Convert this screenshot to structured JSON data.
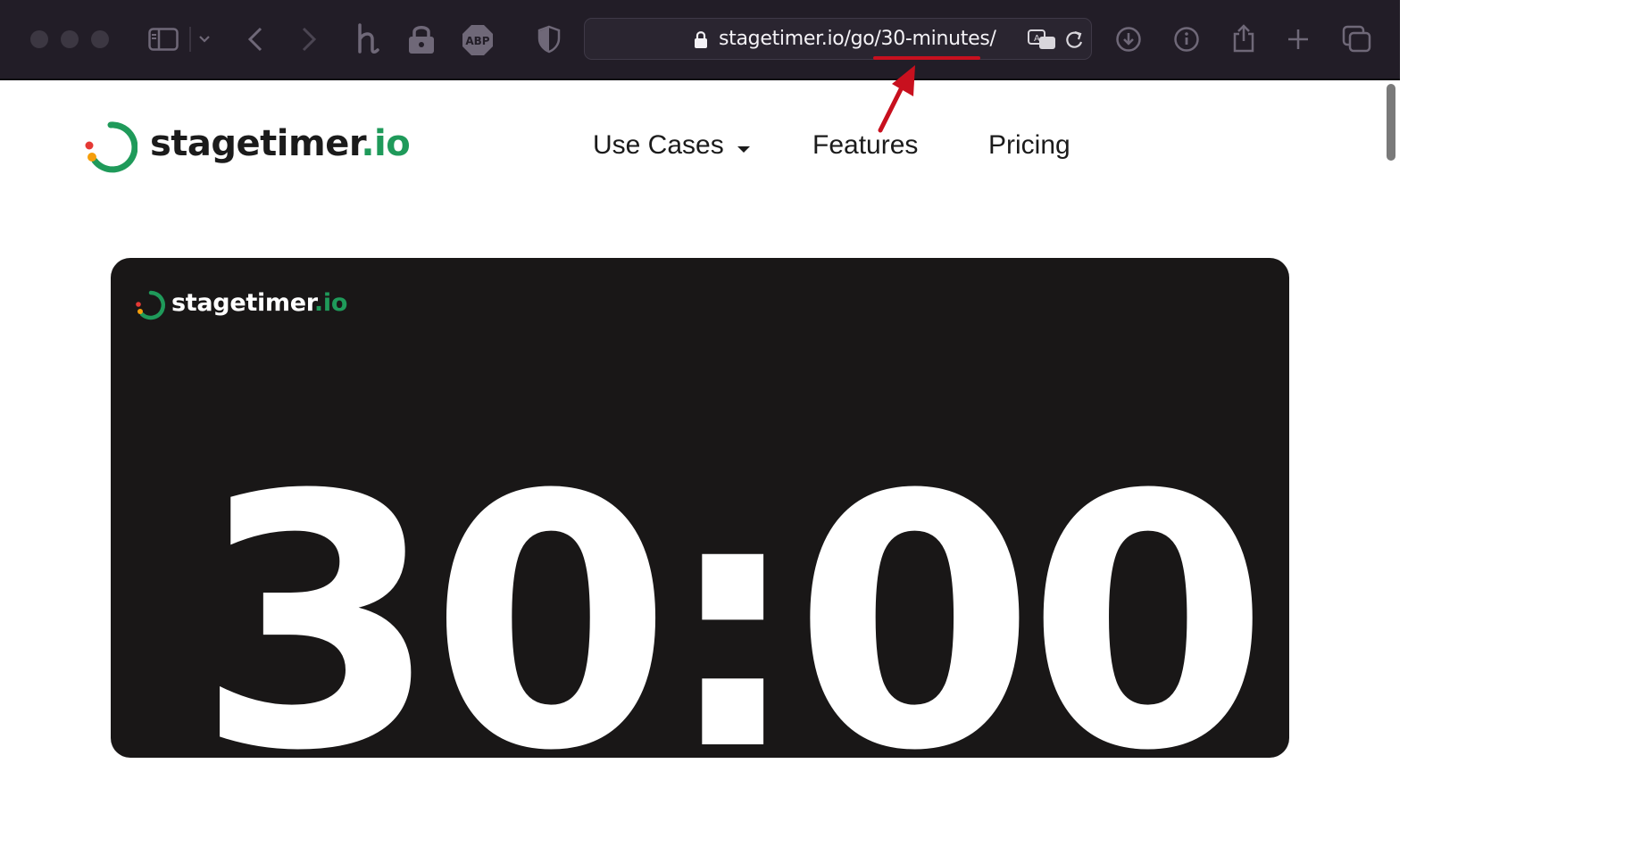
{
  "browser": {
    "url": "stagetimer.io/go/30-minutes/",
    "icons": [
      "sidebar-icon",
      "chevron-down-icon",
      "back-icon",
      "forward-icon",
      "honey-extension-icon",
      "lock-extension-icon",
      "adblock-plus-icon",
      "privacy-shield-icon",
      "translate-icon",
      "reload-icon",
      "download-icon",
      "info-icon",
      "share-icon",
      "new-tab-icon",
      "tab-overview-icon"
    ],
    "annotation_color": "#c8101e"
  },
  "site": {
    "logo_main": "stagetimer",
    "logo_suffix": ".io",
    "nav": {
      "use_cases": "Use Cases",
      "features": "Features",
      "pricing": "Pricing"
    }
  },
  "timer": {
    "logo_main": "stagetimer",
    "logo_suffix": ".io",
    "display": "30:00"
  },
  "colors": {
    "brand_green": "#1f9a5a",
    "brand_red": "#e53935",
    "brand_orange": "#f59e0b",
    "card_bg": "#191717"
  }
}
